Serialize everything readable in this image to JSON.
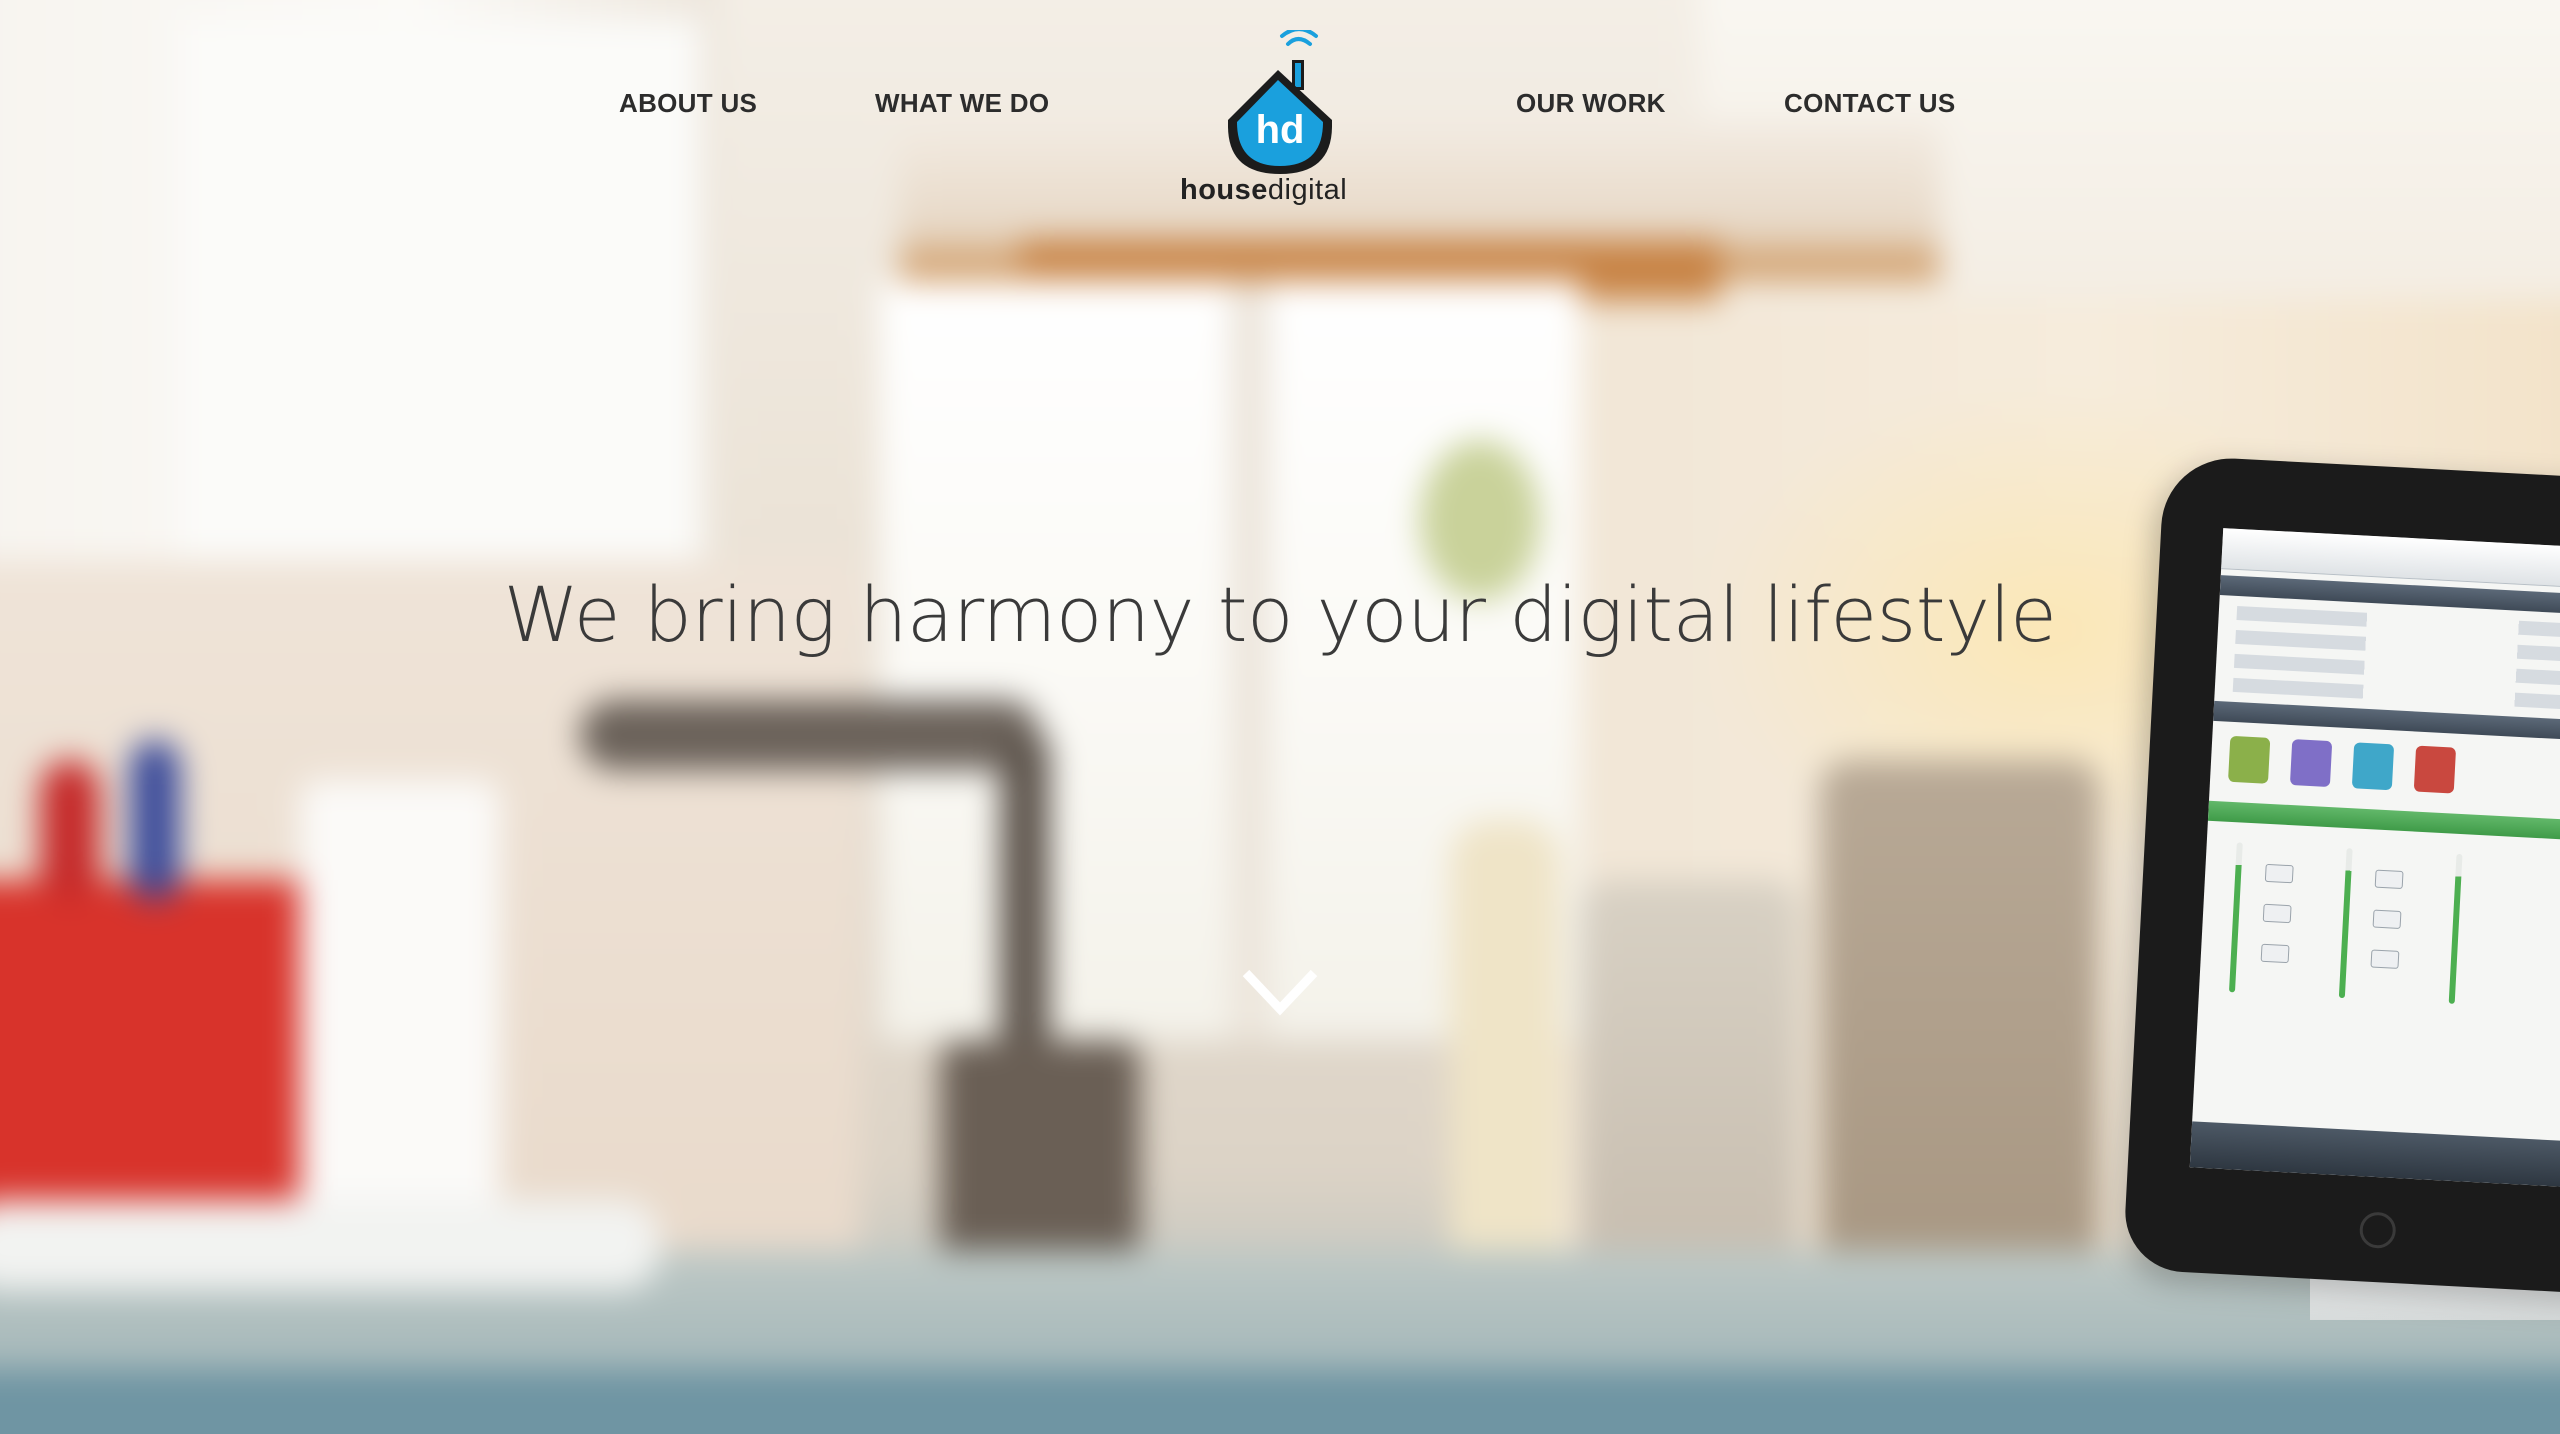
{
  "nav": {
    "about_label": "ABOUT US",
    "what_we_do_label": "WHAT WE DO",
    "our_work_label": "OUR WORK",
    "contact_label": "CONTACT US"
  },
  "logo": {
    "monogram": "hd",
    "word_strong": "house",
    "word_light": "digital"
  },
  "hero": {
    "headline": "We bring harmony to your digital lifestyle"
  },
  "icons": {
    "scroll_down": "chevron-down-icon",
    "wifi": "wifi-icon",
    "house": "house-icon"
  },
  "colors": {
    "nav_text": "#2c2c2c",
    "headline_text": "#3a3a3a",
    "logo_blue": "#1aa0dd",
    "logo_dark": "#1c1c1c"
  }
}
